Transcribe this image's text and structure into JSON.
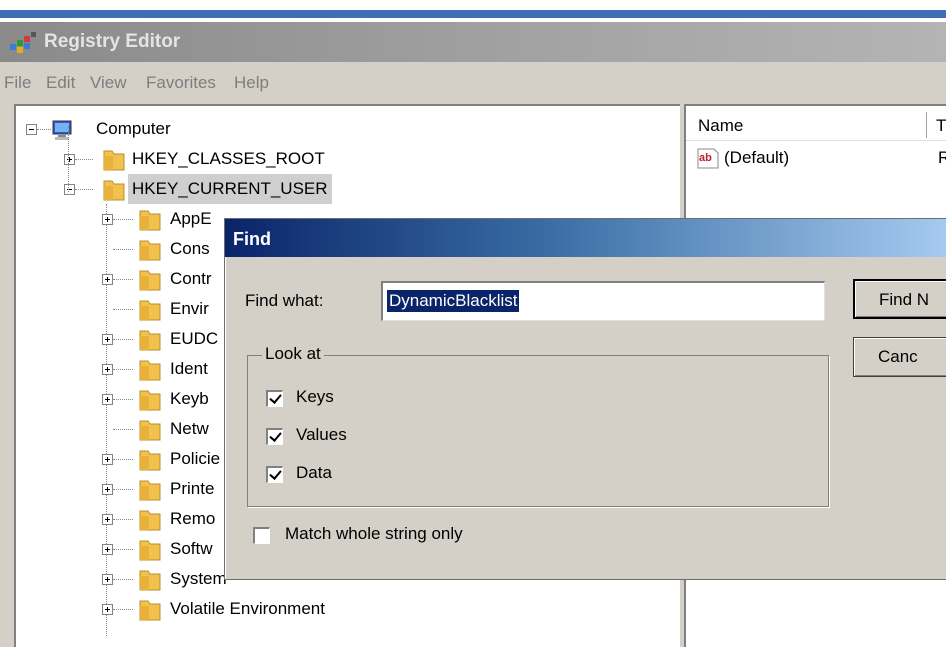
{
  "window": {
    "title": "Registry Editor"
  },
  "menu": [
    "File",
    "Edit",
    "View",
    "Favorites",
    "Help"
  ],
  "tree": {
    "root": "Computer",
    "hives": [
      "HKEY_CLASSES_ROOT",
      "HKEY_CURRENT_USER"
    ],
    "selected": "HKEY_CURRENT_USER",
    "subkeys": [
      "AppE",
      "Cons",
      "Contr",
      "Envir",
      "EUDC",
      "Ident",
      "Keyb",
      "Netw",
      "Policie",
      "Printe",
      "Remo",
      "Softw",
      "System",
      "Volatile Environment"
    ]
  },
  "values_pane": {
    "columns": [
      "Name",
      "T"
    ],
    "rows": [
      {
        "name": "(Default)",
        "type": "R"
      }
    ]
  },
  "find_dialog": {
    "title": "Find",
    "find_what_label": "Find what:",
    "find_what_value": "DynamicBlacklist",
    "find_next_label": "Find N",
    "cancel_label": "Canc",
    "look_at_label": "Look at",
    "options": [
      {
        "label": "Keys",
        "checked": true
      },
      {
        "label": "Values",
        "checked": true
      },
      {
        "label": "Data",
        "checked": true
      }
    ],
    "match_whole": {
      "label": "Match whole string only",
      "checked": false
    }
  }
}
